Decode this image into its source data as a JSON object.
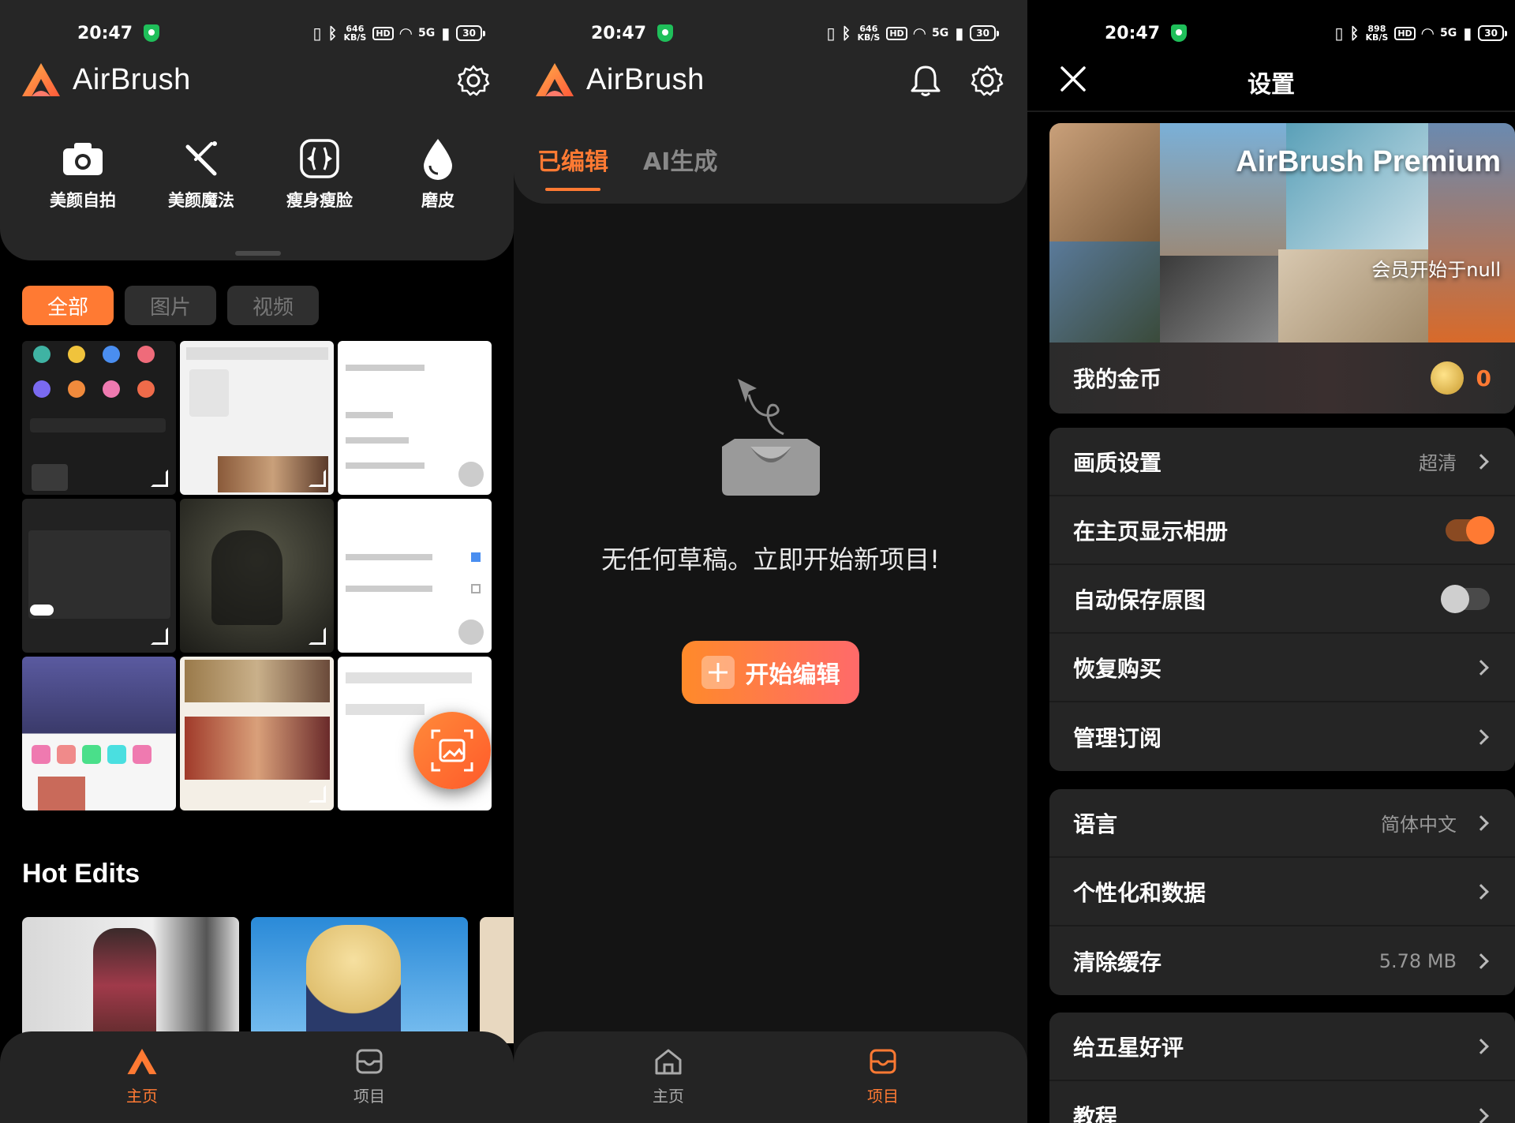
{
  "status": {
    "time": "20:47",
    "speed1": "646",
    "speed2": "646",
    "speed3": "898",
    "speed_unit": "KB/S",
    "hd": "HD",
    "network": "5G",
    "battery": "30"
  },
  "app": {
    "name": "AirBrush",
    "accent": "#ff7a33"
  },
  "home": {
    "tools": [
      {
        "label": "美颜自拍",
        "icon": "camera-icon"
      },
      {
        "label": "美颜魔法",
        "icon": "magic-wand-icon"
      },
      {
        "label": "瘦身瘦脸",
        "icon": "slim-face-icon"
      },
      {
        "label": "磨皮",
        "icon": "water-drop-icon"
      }
    ],
    "filters": [
      "全部",
      "图片",
      "视频"
    ],
    "hot_title": "Hot Edits",
    "nav": [
      "主页",
      "项目"
    ]
  },
  "projects": {
    "tabs": [
      "已编辑",
      "AI生成"
    ],
    "empty_message": "无任何草稿。立即开始新项目!",
    "start_button": "开始编辑",
    "nav": [
      "主页",
      "项目"
    ]
  },
  "settings": {
    "title": "设置",
    "premium_title": "AirBrush Premium",
    "premium_sub": "会员开始于null",
    "coins_label": "我的金币",
    "coins_value": "0",
    "group1": [
      {
        "label": "画质设置",
        "value": "超清",
        "type": "chevron"
      },
      {
        "label": "在主页显示相册",
        "value": "",
        "type": "toggle-on"
      },
      {
        "label": "自动保存原图",
        "value": "",
        "type": "toggle-off"
      },
      {
        "label": "恢复购买",
        "value": "",
        "type": "chevron"
      },
      {
        "label": "管理订阅",
        "value": "",
        "type": "chevron"
      }
    ],
    "group2": [
      {
        "label": "语言",
        "value": "简体中文",
        "type": "chevron"
      },
      {
        "label": "个性化和数据",
        "value": "",
        "type": "chevron"
      },
      {
        "label": "清除缓存",
        "value": "5.78 MB",
        "type": "chevron"
      }
    ],
    "group3": [
      {
        "label": "给五星好评",
        "value": "",
        "type": "chevron"
      },
      {
        "label": "教程",
        "value": "",
        "type": "chevron"
      }
    ]
  }
}
